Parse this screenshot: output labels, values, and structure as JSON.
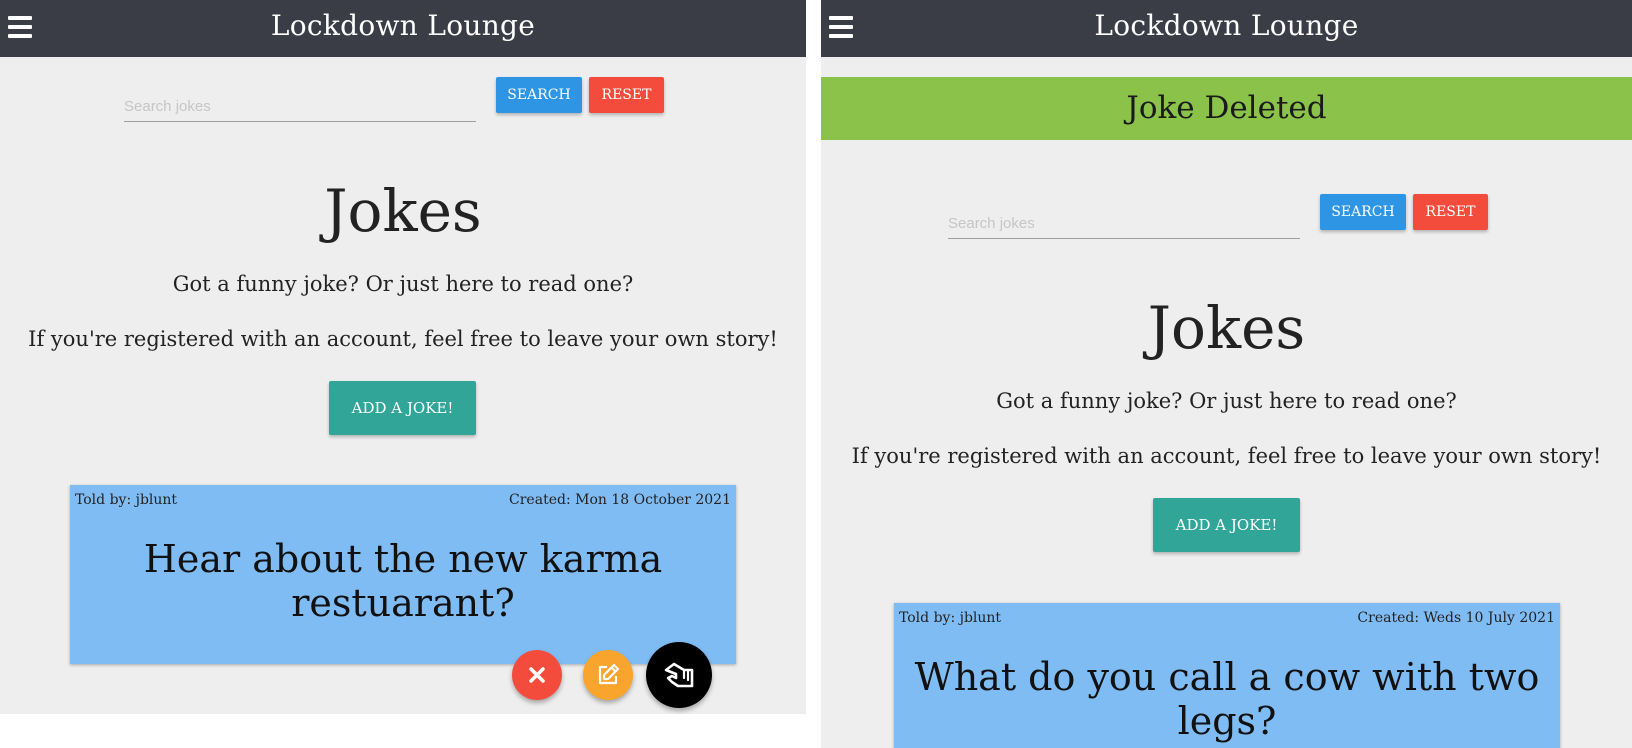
{
  "screens": [
    {
      "navbar": {
        "brand": "Lockdown Lounge",
        "menu_icon": "hamburger-menu-icon"
      },
      "search": {
        "placeholder": "Search jokes",
        "search_label": "Search",
        "reset_label": "Reset"
      },
      "heading": "Jokes",
      "subtitle_1": "Got a funny joke? Or just here to read one?",
      "subtitle_2": "If you're registered with an account, feel free to leave your own story!",
      "add_button": "Add a joke!",
      "joke": {
        "author": "Told by: jblunt",
        "created": "Created: Mon 18 October 2021",
        "text": "Hear about the new karma restuarant?"
      },
      "fab": {
        "delete_icon": "close-icon",
        "edit_icon": "edit-icon",
        "main_icon": "hand-pointer-icon"
      }
    },
    {
      "navbar": {
        "brand": "Lockdown Lounge",
        "menu_icon": "hamburger-menu-icon"
      },
      "alert": "Joke Deleted",
      "search": {
        "placeholder": "Search jokes",
        "search_label": "Search",
        "reset_label": "Reset"
      },
      "heading": "Jokes",
      "subtitle_1": "Got a funny joke? Or just here to read one?",
      "subtitle_2": "If you're registered with an account, feel free to leave your own story!",
      "add_button": "Add a joke!",
      "joke": {
        "author": "Told by: jblunt",
        "created": "Created: Weds 10 July 2021",
        "text": "What do you call a cow with two legs?"
      }
    }
  ],
  "colors": {
    "navbar": "#3a3d46",
    "page_background": "#eeeeee",
    "search_button": "#2d95e3",
    "reset_button": "#f44c3c",
    "add_button": "#31a597",
    "joke_card": "#80bcf4",
    "alert_success": "#8bc34a",
    "fab_delete": "#f44c3c",
    "fab_edit": "#f9a42c",
    "fab_main": "#000000"
  }
}
